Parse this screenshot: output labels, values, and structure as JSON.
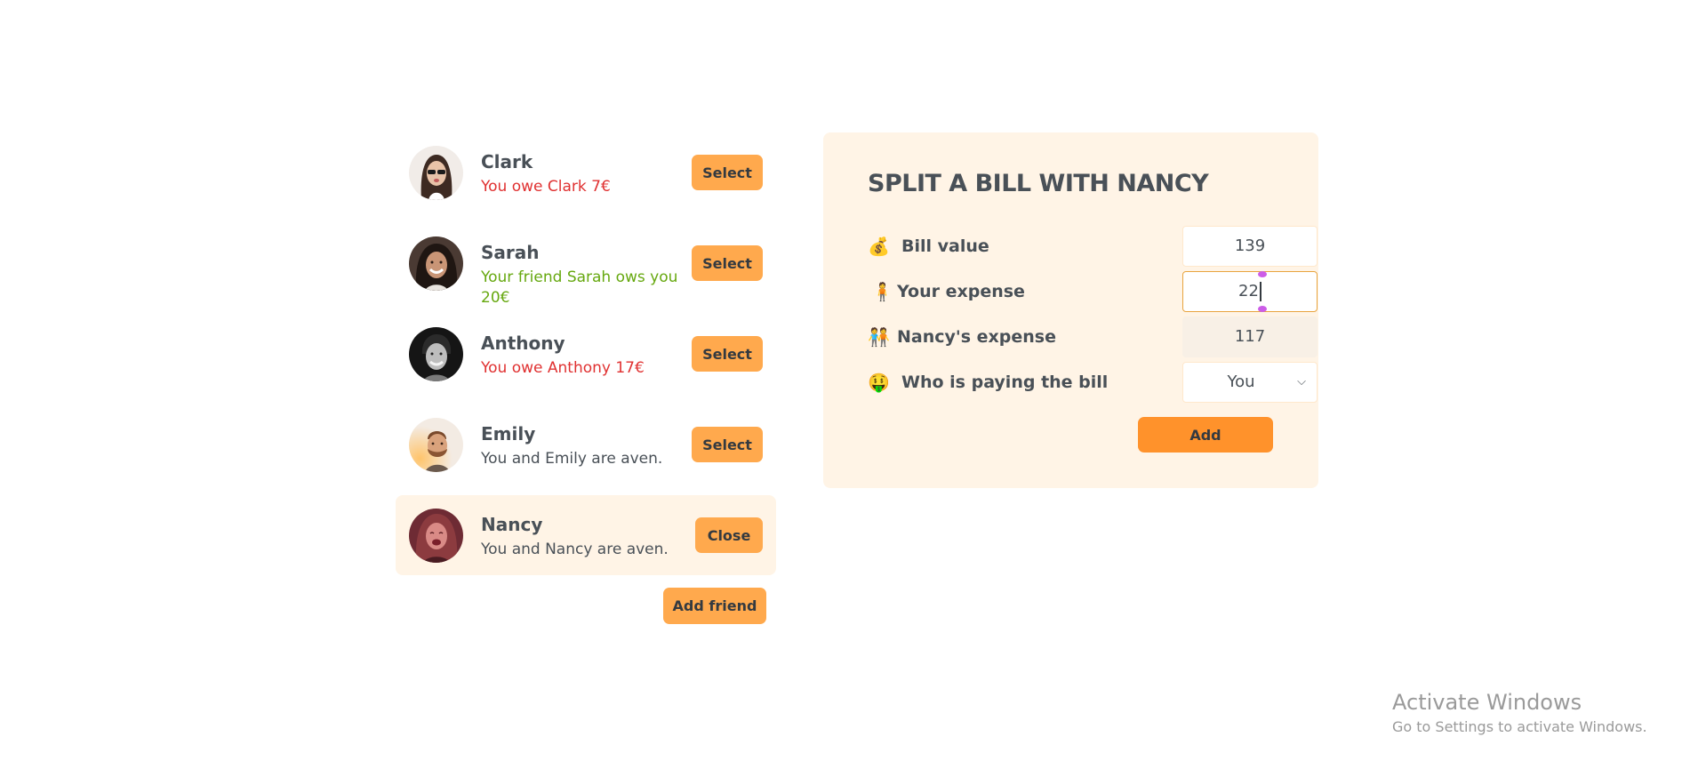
{
  "friends": [
    {
      "name": "Clark",
      "status": "You owe Clark 7€",
      "status_type": "red",
      "button_label": "Select",
      "avatar_icon": "avatar-clark",
      "selected": false
    },
    {
      "name": "Sarah",
      "status": "Your friend Sarah ows you 20€",
      "status_type": "green",
      "button_label": "Select",
      "avatar_icon": "avatar-sarah",
      "selected": false
    },
    {
      "name": "Anthony",
      "status": "You owe Anthony 17€",
      "status_type": "red",
      "button_label": "Select",
      "avatar_icon": "avatar-anthony",
      "selected": false
    },
    {
      "name": "Emily",
      "status": "You and Emily are aven.",
      "status_type": "neutral",
      "button_label": "Select",
      "avatar_icon": "avatar-emily",
      "selected": false
    },
    {
      "name": "Nancy",
      "status": "You and Nancy are aven.",
      "status_type": "neutral",
      "button_label": "Close",
      "avatar_icon": "avatar-nancy",
      "selected": true
    }
  ],
  "add_friend_label": "Add friend",
  "split_form": {
    "title": "SPLIT A BILL WITH NANCY",
    "bill_value": {
      "icon": "💰",
      "label": "Bill value",
      "value": "139"
    },
    "your_expense": {
      "icon": "🧍",
      "label": "Your expense",
      "value": "22"
    },
    "friend_expense": {
      "icon": "🧑‍🤝‍🧑",
      "label": "Nancy's expense",
      "value": "117"
    },
    "who_pays": {
      "icon": "🤑",
      "label": "Who is paying the bill",
      "selected": "You"
    },
    "add_label": "Add"
  },
  "colors": {
    "accent": "#ffa94d",
    "accent_strong": "#ff922b",
    "panel_bg": "#fff4e6",
    "owe_red": "#e03131",
    "owed_green": "#66a80f"
  },
  "watermark": {
    "title": "Activate Windows",
    "subtitle": "Go to Settings to activate Windows."
  }
}
